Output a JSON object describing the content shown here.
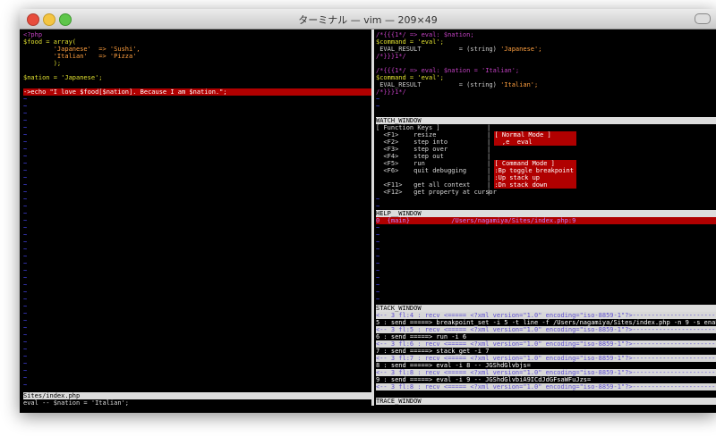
{
  "window": {
    "title": "ターミナル — vim — 209×49"
  },
  "left": {
    "code": [
      {
        "t": "<?php",
        "c": "mag"
      },
      {
        "t": "$food = array(",
        "c": "kw"
      },
      {
        "t": "        'Japanese'  => 'Sushi',",
        "c": "str"
      },
      {
        "t": "        'Italian'   => 'Pizza'",
        "c": "str"
      },
      {
        "t": "        );",
        "c": "kw"
      },
      {
        "t": "",
        "c": ""
      },
      {
        "t": "$nation = 'Japanese';",
        "c": "kw"
      },
      {
        "t": "",
        "c": ""
      },
      {
        "t": "->echo \"I love $food[$nation]. Because I am $nation.\";",
        "c": "cur"
      }
    ],
    "status": "Sites/index.php",
    "cmdline": "eval -- $nation = 'Italian';"
  },
  "watch": {
    "lines": [
      "/*{{{1*/ => eval: $nation;",
      "$command = 'eval';",
      " EVAL_RESULT          = (string) 'Japanese';",
      "/*}}}1*/",
      "",
      "/*{{{1*/ => eval: $nation = 'Italian';",
      "$command = 'eval';",
      " EVAL_RESULT          = (string) 'Italian';",
      "/*}}}1*/"
    ],
    "status": "WATCH_WINDOW"
  },
  "help": {
    "left": [
      "[ Function Keys ]",
      "  <F1>    resize",
      "  <F2>    step into",
      "  <F3>    step over",
      "  <F4>    step out",
      "  <F5>    run",
      "  <F6>    quit debugging",
      "",
      "  <F11>   get all context",
      "  <F12>   get property at cursor"
    ],
    "right": [
      "",
      "[ Normal Mode ]",
      "  ,e  eval",
      "",
      "",
      "[ Command Mode ]",
      ":Bp toggle breakpoint",
      ":Up stack up",
      ":Dn stack down",
      ""
    ],
    "status": "HELP__WINDOW"
  },
  "stack": {
    "line": "0  {main}           /Users/nagamiya/Sites/index.php:9",
    "status": "STACK_WINDOW"
  },
  "trace": {
    "lines": [
      {
        "t": "<-- 3 fl:4 : recv <===== <?xml version=\"1.0\" encoding=\"iso-8859-1\"?>---------------------------------------",
        "s": "sel"
      },
      {
        "t": "5 : send =====> breakpoint_set -i 5 -t line -f /Users/nagamiya/Sites/index.php -n 9 -s enabled",
        "s": ""
      },
      {
        "t": "<-- 3 fl:5 : recv <===== <?xml version=\"1.0\" encoding=\"iso-8859-1\"?>---------------------------------------",
        "s": "sel"
      },
      {
        "t": "6 : send =====> run -i 6",
        "s": ""
      },
      {
        "t": "<-- 3 fl:6 : recv <===== <?xml version=\"1.0\" encoding=\"iso-8859-1\"?>---------------------------------------",
        "s": "sel"
      },
      {
        "t": "7 : send =====> stack_get -i 7",
        "s": ""
      },
      {
        "t": "<-- 3 fl:7 : recv <===== <?xml version=\"1.0\" encoding=\"iso-8859-1\"?>---------------------------------------",
        "s": "sel"
      },
      {
        "t": "8 : send =====> eval -i 8 -- JGShdGlvbjs=",
        "s": ""
      },
      {
        "t": "<-- 3 fl:8 : recv <===== <?xml version=\"1.0\" encoding=\"iso-8859-1\"?>---------------------------------------",
        "s": "sel"
      },
      {
        "t": "9 : send =====> eval -i 9 -- JGShdGlvbiA9ICdJdGFsaWFuJzs=",
        "s": ""
      },
      {
        "t": "<-- 3 fl:8 : recv <===== <?xml version=\"1.0\" encoding=\"iso-8859-1\"?>---------------------------------------",
        "s": "sel"
      }
    ],
    "status": "TRACE_WINDOW"
  },
  "tilde": "~"
}
